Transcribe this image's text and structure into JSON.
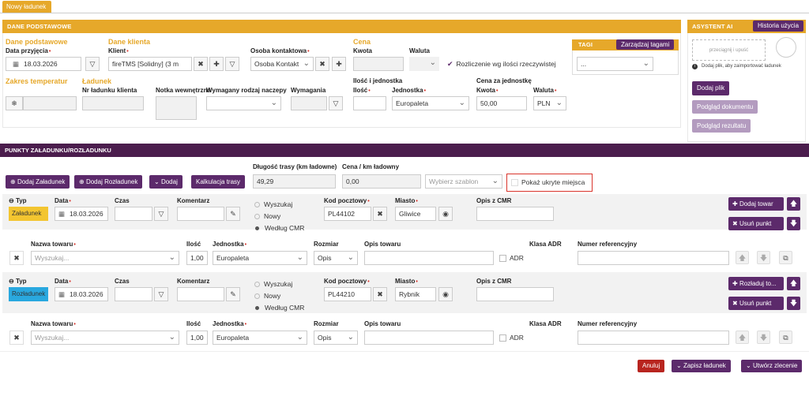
{
  "tab": {
    "label": "Nowy ładunek"
  },
  "basic": {
    "header": "DANE PODSTAWOWE",
    "section_basic": "Dane podstawowe",
    "date_label": "Data przyjęcia",
    "date_value": "18.03.2026",
    "section_client": "Dane klienta",
    "client_label": "Klient",
    "client_value": "fireTMS [Solidny] (3 m",
    "contact_label": "Osoba kontaktowa",
    "contact_value": "Osoba Kontakt",
    "section_price": "Cena",
    "amount_label": "Kwota",
    "currency_label": "Waluta",
    "settle_label": "Rozliczenie wg ilości rzeczywistej",
    "section_temp": "Zakres temperatur",
    "section_load": "Ładunek",
    "client_no_label": "Nr ładunku klienta",
    "internal_label": "Notka wewnętrzna",
    "trailer_label": "Wymagany rodzaj naczepy",
    "requirements_label": "Wymagania",
    "qty_unit_label": "Ilość i jednostka",
    "qty_label": "Ilość",
    "unit_label": "Jednostka",
    "unit_value": "Europaleta",
    "unit_price_label": "Cena za jednostkę",
    "unit_amount_label": "Kwota",
    "unit_amount_value": "50,00",
    "unit_currency_label": "Waluta",
    "unit_currency_value": "PLN"
  },
  "tags": {
    "title": "TAGI",
    "manage": "Zarządzaj tagami",
    "select_value": "..."
  },
  "assistant": {
    "header": "ASYSTENT AI",
    "history": "Historia użycia",
    "dropzone": "przeciągnij i upuść",
    "hint": "Dodaj plik, aby zaimportować ładunek",
    "add_file": "Dodaj plik",
    "preview_doc": "Podgląd dokumentu",
    "preview_result": "Podgląd rezultatu"
  },
  "points": {
    "header": "PUNKTY ZAŁADUNKU/ROZŁADUNKU",
    "add_loading": "Dodaj Załadunek",
    "add_unloading": "Dodaj Rozładunek",
    "add": "Dodaj",
    "route_calc": "Kalkulacja trasy",
    "route_len_label": "Długość trasy (km ładowne)",
    "route_len_value": "49,29",
    "price_km_label": "Cena / km ładowny",
    "price_km_value": "0,00",
    "template_placeholder": "Wybierz szablon",
    "show_hidden": "Pokaż ukryte miejsca"
  },
  "cols": {
    "type": "Typ",
    "date": "Data",
    "time": "Czas",
    "comment": "Komentarz",
    "search": "Wyszukaj",
    "new": "Nowy",
    "by_cmr": "Według CMR",
    "postal": "Kod pocztowy",
    "city": "Miasto",
    "cmr_desc": "Opis z CMR",
    "goods_name": "Nazwa towaru",
    "qty": "Ilość",
    "unit": "Jednostka",
    "size": "Rozmiar",
    "goods_desc": "Opis towaru",
    "adr_class": "Klasa ADR",
    "ref_no": "Numer referencyjny",
    "search_placeholder": "Wyszukaj...",
    "adr": "ADR",
    "qty_value": "1,00",
    "unit_value": "Europaleta",
    "size_value": "Opis"
  },
  "stop1": {
    "type": "Załadunek",
    "type_color": "#f3c530",
    "date": "18.03.2026",
    "postal": "PL44102",
    "city": "Gliwice",
    "add_btn": "Dodaj towar",
    "remove_btn": "Usuń punkt"
  },
  "stop2": {
    "type": "Rozładunek",
    "type_color": "#29a8df",
    "date": "18.03.2026",
    "postal": "PL44210",
    "city": "Rybnik",
    "add_btn": "Rozładuj to...",
    "remove_btn": "Usuń punkt"
  },
  "footer": {
    "cancel": "Anuluj",
    "save": "Zapisz ładunek",
    "create": "Utwórz zlecenie"
  },
  "colors": {
    "accent_yellow": "#e6a82a",
    "accent_purple": "#4b1d4d",
    "danger": "#b8251f"
  }
}
